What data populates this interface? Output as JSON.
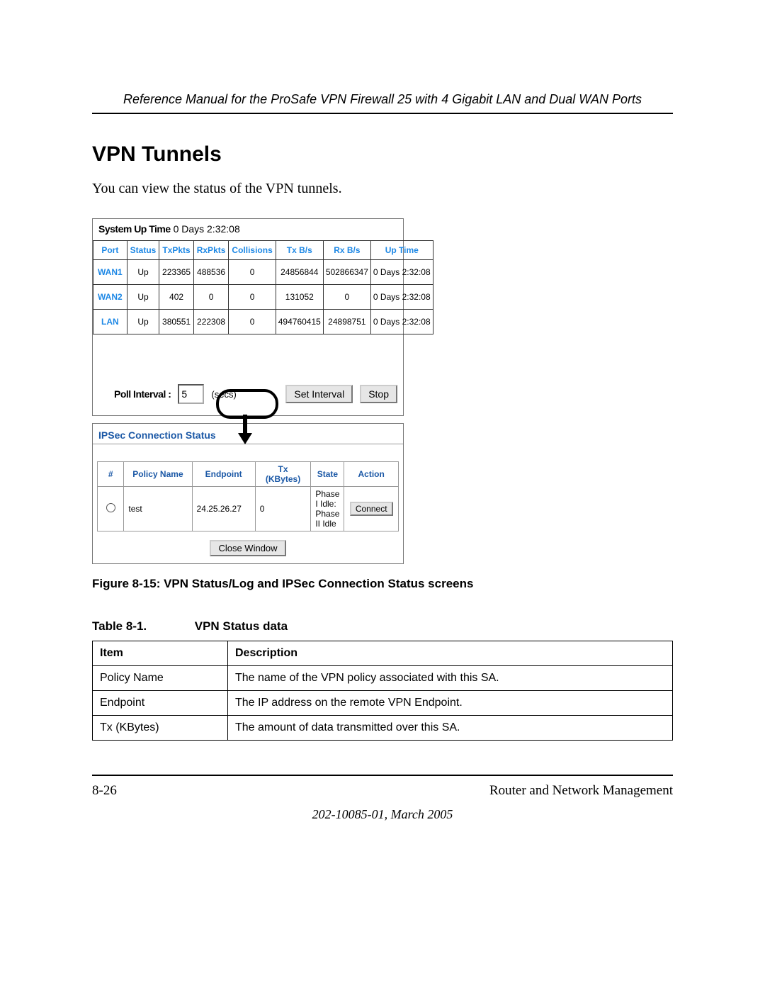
{
  "header": {
    "running_head": "Reference Manual for the ProSafe VPN Firewall 25 with 4 Gigabit LAN and Dual WAN Ports"
  },
  "section": {
    "title": "VPN Tunnels",
    "intro": "You can view the status of the VPN tunnels."
  },
  "status_panel": {
    "uptime_label": "System Up Time",
    "uptime_value": "0 Days 2:32:08",
    "headers": {
      "port": "Port",
      "status": "Status",
      "txpkts": "TxPkts",
      "rxpkts": "RxPkts",
      "collisions": "Collisions",
      "txbs": "Tx B/s",
      "rxbs": "Rx B/s",
      "uptime": "Up Time"
    },
    "rows": [
      {
        "port": "WAN1",
        "status": "Up",
        "txpkts": "223365",
        "rxpkts": "488536",
        "collisions": "0",
        "txbs": "24856844",
        "rxbs": "502866347",
        "uptime": "0 Days 2:32:08"
      },
      {
        "port": "WAN2",
        "status": "Up",
        "txpkts": "402",
        "rxpkts": "0",
        "collisions": "0",
        "txbs": "131052",
        "rxbs": "0",
        "uptime": "0 Days 2:32:08"
      },
      {
        "port": "LAN",
        "status": "Up",
        "txpkts": "380551",
        "rxpkts": "222308",
        "collisions": "0",
        "txbs": "494760415",
        "rxbs": "24898751",
        "uptime": "0 Days 2:32:08"
      }
    ],
    "poll": {
      "label": "Poll Interval :",
      "value": "5",
      "unit": "(secs)",
      "set_btn": "Set Interval",
      "stop_btn": "Stop"
    }
  },
  "ipsec_panel": {
    "title": "IPSec Connection Status",
    "headers": {
      "num": "#",
      "policy": "Policy Name",
      "endpoint": "Endpoint",
      "tx": "Tx (KBytes)",
      "state": "State",
      "action": "Action"
    },
    "rows": [
      {
        "policy": "test",
        "endpoint": "24.25.26.27",
        "tx": "0",
        "state": "Phase I Idle: Phase II Idle",
        "action": "Connect"
      }
    ],
    "close_btn": "Close Window"
  },
  "figure_caption": "Figure 8-15:  VPN Status/Log and IPSec Connection Status screens",
  "table_caption": {
    "num": "Table 8-1.",
    "title": "VPN Status data"
  },
  "desc_table": {
    "headers": {
      "item": "Item",
      "desc": "Description"
    },
    "rows": [
      {
        "item": "Policy Name",
        "desc": "The name of the VPN policy associated with this SA."
      },
      {
        "item": "Endpoint",
        "desc": "The IP address on the remote VPN Endpoint."
      },
      {
        "item": "Tx (KBytes)",
        "desc": "The amount of data transmitted over this SA."
      }
    ]
  },
  "footer": {
    "page": "8-26",
    "section": "Router and Network Management",
    "docid": "202-10085-01, March 2005"
  }
}
